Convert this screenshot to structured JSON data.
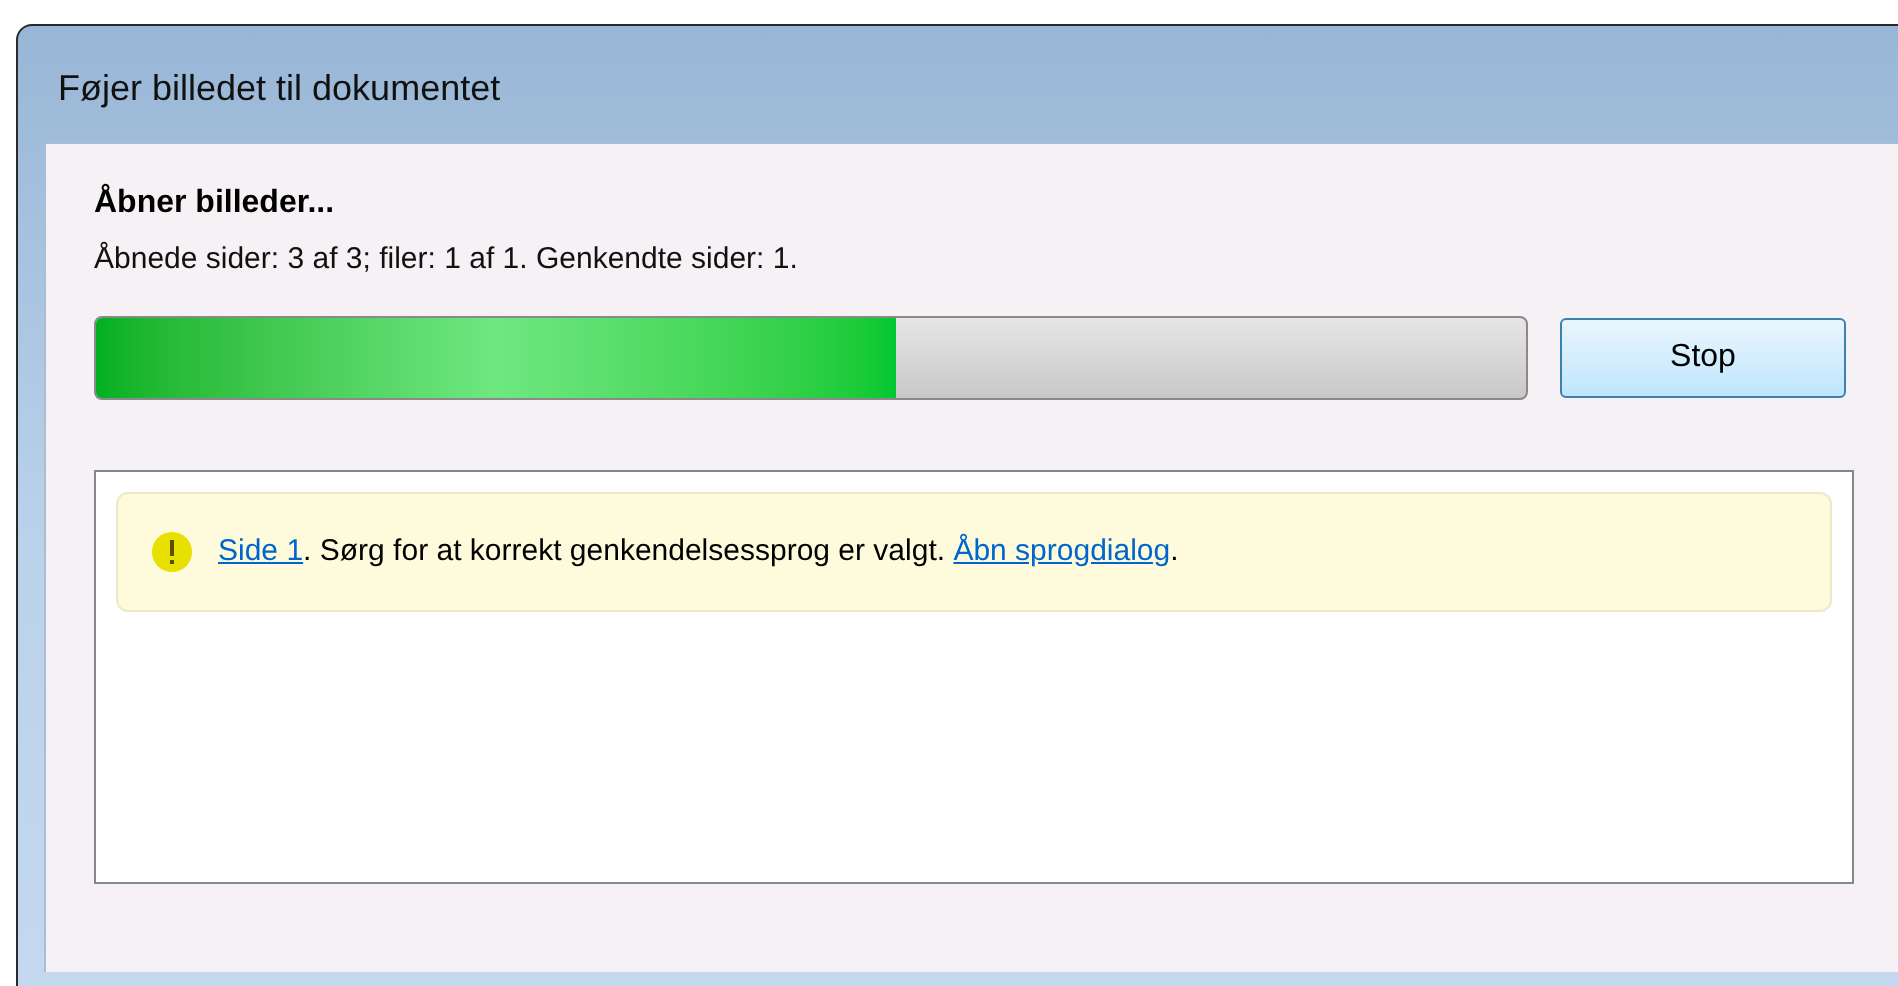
{
  "window": {
    "title": "Føjer billedet til dokumentet"
  },
  "status": {
    "heading": "Åbner billeder...",
    "detail": "Åbnede sider: 3 af 3; filer: 1 af 1. Genkendte sider: 1."
  },
  "progress": {
    "level": 0.56
  },
  "buttons": [
    {
      "label": "Stop"
    }
  ],
  "messages": [
    {
      "kind": "warning",
      "parts": [
        {
          "kind": "link",
          "text": "Side 1"
        },
        {
          "kind": "text",
          "text": ". Sørg for at korrekt genkendelsessprog er valgt. "
        },
        {
          "kind": "link",
          "text": "Åbn sprogdialog"
        },
        {
          "kind": "text",
          "text": "."
        }
      ]
    }
  ]
}
